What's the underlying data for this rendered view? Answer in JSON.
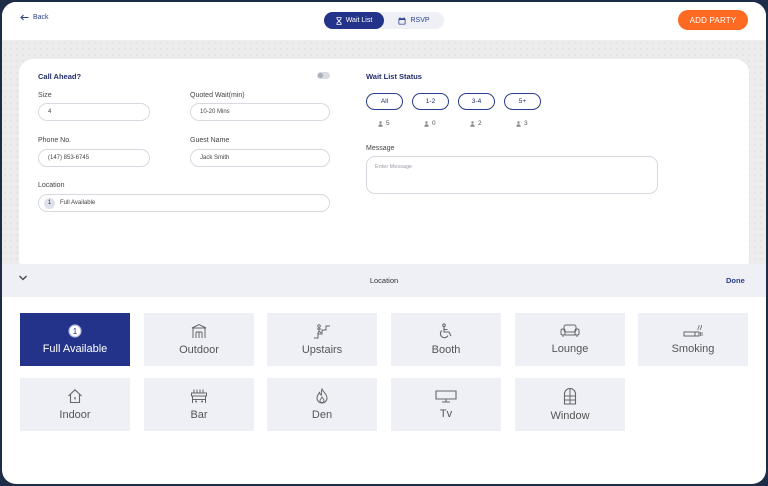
{
  "header": {
    "back_label": "Back",
    "tabs": [
      {
        "label": "Wait List",
        "icon": "hourglass-icon",
        "active": true
      },
      {
        "label": "RSVP",
        "icon": "calendar-icon",
        "active": false
      }
    ],
    "add_party_label": "ADD PARTY"
  },
  "form": {
    "call_ahead_label": "Call Ahead?",
    "call_ahead_enabled": false,
    "size": {
      "label": "Size",
      "value": "4"
    },
    "quoted_wait": {
      "label": "Quoted Wait(min)",
      "value": "10-20 Mins"
    },
    "phone": {
      "label": "Phone No.",
      "value": "(147) 853-6745"
    },
    "guest_name": {
      "label": "Guest Name",
      "value": "Jack Smith"
    },
    "location": {
      "label": "Location",
      "badge": "1",
      "value": "Full Available"
    }
  },
  "wait_list_status": {
    "title": "Wait List Status",
    "filters": [
      {
        "label": "All",
        "count": "5",
        "selected": true
      },
      {
        "label": "1-2",
        "count": "0",
        "selected": false
      },
      {
        "label": "3-4",
        "count": "2",
        "selected": false
      },
      {
        "label": "5+",
        "count": "3",
        "selected": false
      }
    ],
    "message_label": "Message",
    "message_placeholder": "Enter Message"
  },
  "location_picker": {
    "title": "Location",
    "done_label": "Done",
    "options": [
      {
        "label": "Full Available",
        "icon": "number-one-icon",
        "selected": true
      },
      {
        "label": "Outdoor",
        "icon": "gazebo-icon",
        "selected": false
      },
      {
        "label": "Upstairs",
        "icon": "stairs-icon",
        "selected": false
      },
      {
        "label": "Booth",
        "icon": "wheelchair-icon",
        "selected": false
      },
      {
        "label": "Lounge",
        "icon": "sofa-icon",
        "selected": false
      },
      {
        "label": "Smoking",
        "icon": "cigarette-icon",
        "selected": false
      },
      {
        "label": "Indoor",
        "icon": "house-icon",
        "selected": false
      },
      {
        "label": "Bar",
        "icon": "bar-icon",
        "selected": false
      },
      {
        "label": "Den",
        "icon": "fire-icon",
        "selected": false
      },
      {
        "label": "Tv",
        "icon": "tv-icon",
        "selected": false
      },
      {
        "label": "Window",
        "icon": "window-icon",
        "selected": false
      }
    ]
  },
  "colors": {
    "brand": "#23338a",
    "accent": "#ff6a22",
    "tile_bg": "#eef0f5"
  }
}
